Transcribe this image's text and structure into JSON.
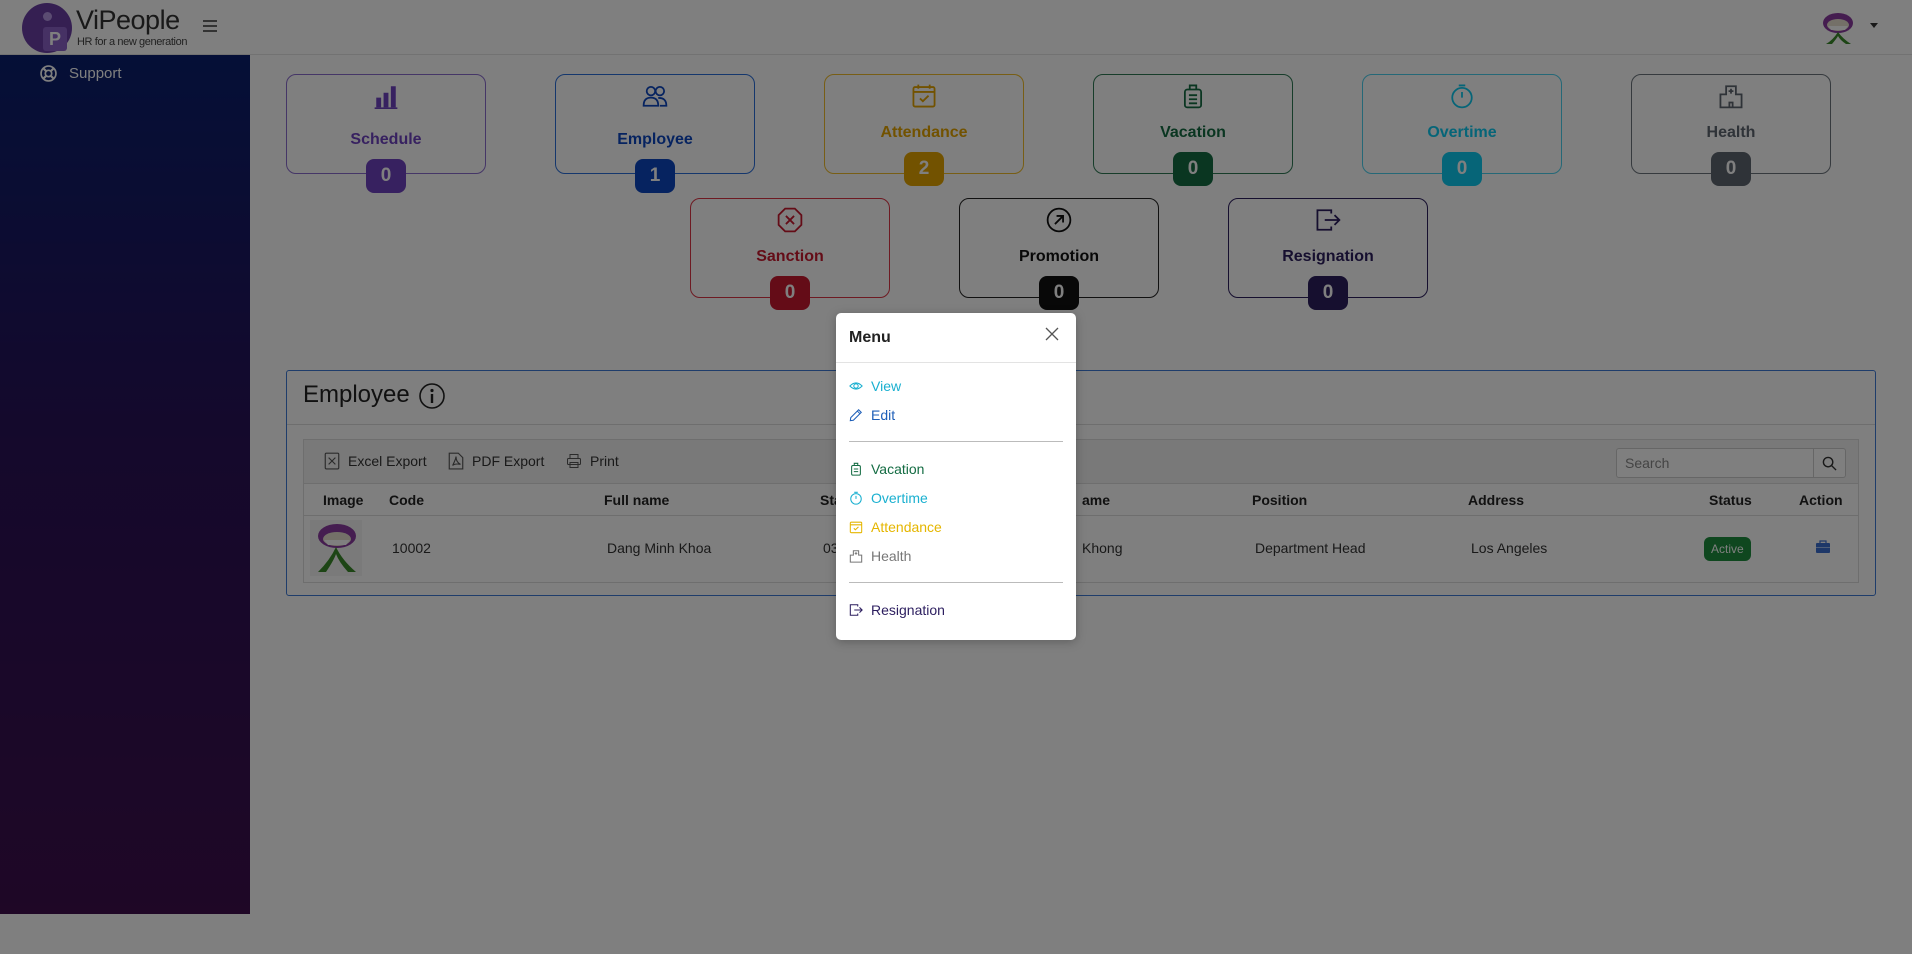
{
  "header": {
    "brand": "ViPeople",
    "tagline": "HR for a new generation",
    "logo_letter": "P"
  },
  "sidebar": {
    "items": [
      {
        "label": "Support",
        "icon": "lifebuoy-icon"
      }
    ]
  },
  "cards": [
    {
      "label": "Schedule",
      "count": "0",
      "color": "#6f42c1",
      "icon": "bar-chart-icon"
    },
    {
      "label": "Employee",
      "count": "1",
      "color": "#0d47c1",
      "icon": "people-icon"
    },
    {
      "label": "Attendance",
      "count": "2",
      "color": "#e5a500",
      "icon": "calendar-check-icon"
    },
    {
      "label": "Vacation",
      "count": "0",
      "color": "#146c43",
      "icon": "luggage-icon"
    },
    {
      "label": "Overtime",
      "count": "0",
      "color": "#0dcaf0",
      "icon": "stopwatch-icon"
    },
    {
      "label": "Health",
      "count": "0",
      "color": "#5f6670",
      "icon": "hospital-icon"
    },
    {
      "label": "Sanction",
      "count": "0",
      "color": "#c9192f",
      "icon": "x-octagon-icon"
    },
    {
      "label": "Promotion",
      "count": "0",
      "color": "#111111",
      "icon": "arrow-up-right-circle-icon"
    },
    {
      "label": "Resignation",
      "count": "0",
      "color": "#2c1e5f",
      "icon": "box-arrow-right-icon"
    }
  ],
  "employee_panel": {
    "title": "Employee",
    "toolbar": {
      "excel": "Excel Export",
      "pdf": "PDF Export",
      "print": "Print",
      "search_placeholder": "Search"
    },
    "columns": [
      "Image",
      "Code",
      "Full name",
      "Sta",
      "ame",
      "Position",
      "Address",
      "Status",
      "Action"
    ],
    "rows": [
      {
        "code": "10002",
        "full_name": "Dang Minh Khoa",
        "start_partial": "03",
        "name_partial": "Khong",
        "position": "Department Head",
        "address": "Los Angeles",
        "status": "Active"
      }
    ]
  },
  "modal": {
    "title": "Menu",
    "items": [
      {
        "label": "View",
        "color": "#1ab0d0",
        "icon": "eye-icon"
      },
      {
        "label": "Edit",
        "color": "#1e5fb8",
        "icon": "pencil-icon"
      },
      {
        "label": "Vacation",
        "color": "#146c43",
        "icon": "luggage-icon"
      },
      {
        "label": "Overtime",
        "color": "#1ab0d0",
        "icon": "stopwatch-icon"
      },
      {
        "label": "Attendance",
        "color": "#e5b600",
        "icon": "calendar-check-icon"
      },
      {
        "label": "Health",
        "color": "#777777",
        "icon": "hospital-icon"
      },
      {
        "label": "Resignation",
        "color": "#2c1e5f",
        "icon": "box-arrow-right-icon"
      }
    ]
  }
}
